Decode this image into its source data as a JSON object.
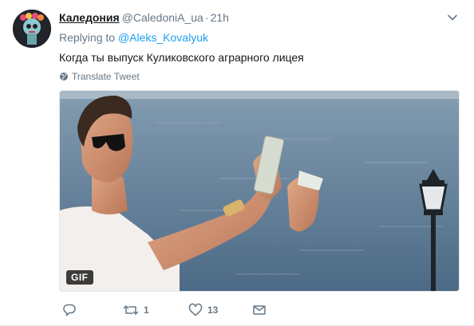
{
  "tweet": {
    "display_name": "Каледония",
    "screen_name": "@CaledoniA_ua",
    "separator": "·",
    "time": "21h",
    "replying_prefix": "Replying to",
    "replying_to": "@Aleks_Kovalyuk",
    "text": "Когда ты выпуск Куликовского аграрного лицея",
    "translate_label": "Translate Tweet",
    "media_badge": "GIF",
    "icons": {
      "avatar": "avatar-image",
      "caret": "chevron-down-icon",
      "translate": "globe-icon",
      "reply": "reply-icon",
      "retweet": "retweet-icon",
      "like": "heart-icon",
      "dm": "envelope-icon"
    },
    "actions": {
      "reply_count": "",
      "retweet_count": "1",
      "like_count": "13"
    }
  },
  "colors": {
    "primary_text": "#14171a",
    "secondary_text": "#657786",
    "link": "#1da1f2",
    "border": "#e6ecf0"
  }
}
